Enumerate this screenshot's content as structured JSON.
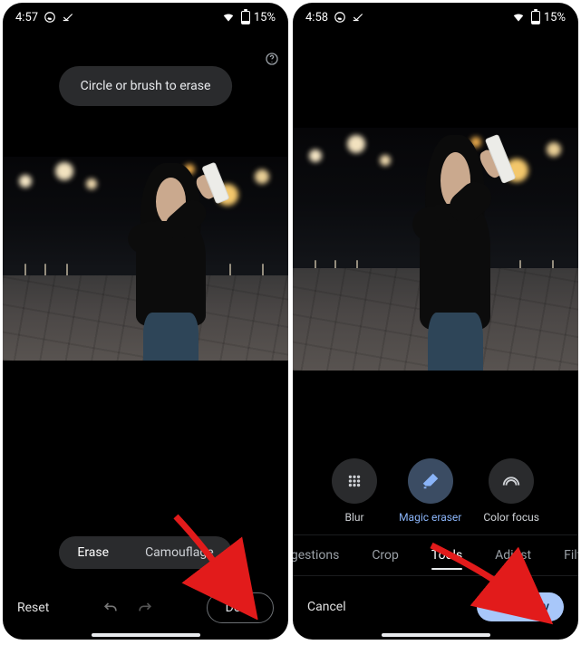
{
  "left": {
    "status": {
      "time": "4:57",
      "battery_label": "15%"
    },
    "tooltip": "Circle or brush to erase",
    "modes": {
      "erase": "Erase",
      "camouflage": "Camouflage"
    },
    "reset": "Reset",
    "done": "Done"
  },
  "right": {
    "status": {
      "time": "4:58",
      "battery_label": "15%"
    },
    "tools": {
      "blur": "Blur",
      "magic_eraser": "Magic eraser",
      "color_focus": "Color focus"
    },
    "tabs": {
      "suggestions": "ggestions",
      "crop": "Crop",
      "tools": "Tools",
      "adjust": "Adjust",
      "filters": "Filters"
    },
    "cancel": "Cancel",
    "save_copy": "Save copy"
  }
}
